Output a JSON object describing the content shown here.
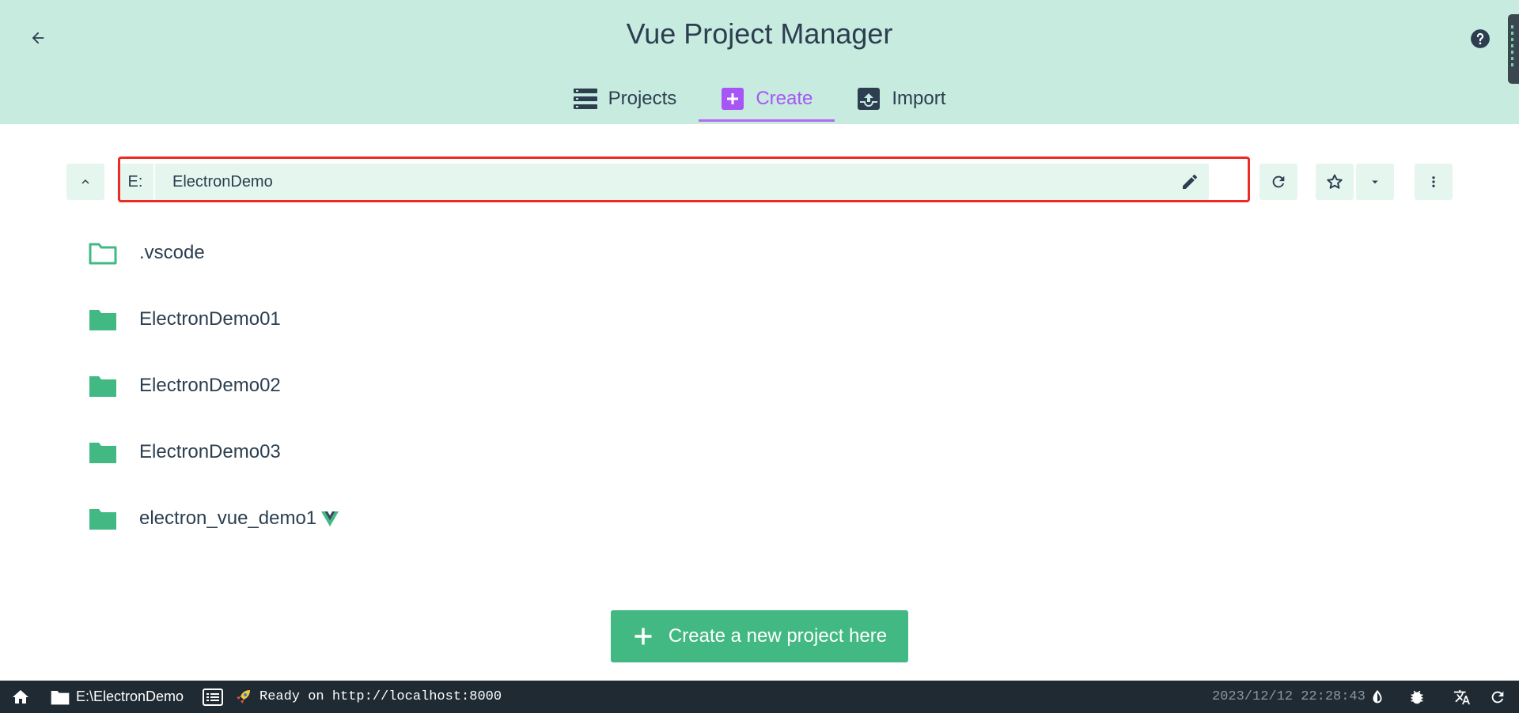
{
  "app": {
    "title": "Vue Project Manager"
  },
  "tabs": [
    {
      "label": "Projects",
      "icon": "list-icon",
      "active": false
    },
    {
      "label": "Create",
      "icon": "plus-box-icon",
      "active": true
    },
    {
      "label": "Import",
      "icon": "import-box-icon",
      "active": false
    }
  ],
  "path_bar": {
    "drive": "E:",
    "folder": "ElectronDemo",
    "highlight_color": "#ee2a24"
  },
  "folders": [
    {
      "name": ".vscode",
      "icon": "folder-outline-icon",
      "is_vue": false
    },
    {
      "name": "ElectronDemo01",
      "icon": "folder-icon",
      "is_vue": false
    },
    {
      "name": "ElectronDemo02",
      "icon": "folder-icon",
      "is_vue": false
    },
    {
      "name": "ElectronDemo03",
      "icon": "folder-icon",
      "is_vue": false
    },
    {
      "name": "electron_vue_demo1",
      "icon": "folder-icon",
      "is_vue": true
    }
  ],
  "create_button": {
    "label": "Create a new project here"
  },
  "statusbar": {
    "cwd": "E:\\ElectronDemo",
    "log": "Ready on http://localhost:8000",
    "time": "2023/12/12 22:28:43"
  },
  "colors": {
    "header_bg": "#c7ebdf",
    "accent_green": "#42b983",
    "active_tab": "#a855f7",
    "text": "#2c3e50",
    "statusbar_bg": "#1f2a33"
  }
}
